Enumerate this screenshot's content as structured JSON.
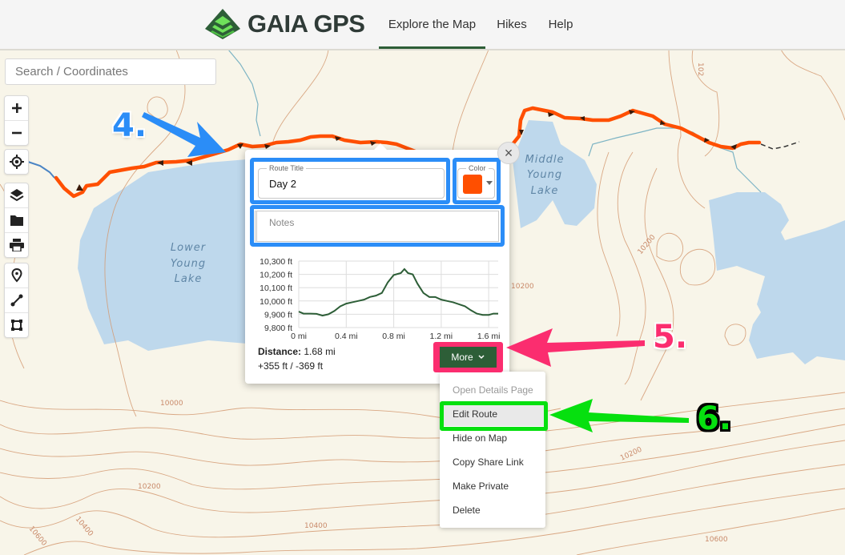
{
  "header": {
    "brand": "GAIA GPS",
    "nav": [
      {
        "label": "Explore the Map",
        "active": true
      },
      {
        "label": "Hikes",
        "active": false
      },
      {
        "label": "Help",
        "active": false
      }
    ]
  },
  "search": {
    "placeholder": "Search / Coordinates",
    "value": ""
  },
  "map_controls": {
    "zoom": [
      "zoom-in",
      "zoom-out"
    ],
    "locate": "locate",
    "tools": [
      "layers",
      "folder",
      "print"
    ],
    "draw": [
      "waypoint",
      "route",
      "area"
    ]
  },
  "map_labels": {
    "lakes": [
      {
        "lines": [
          "Lower",
          "Young",
          "Lake"
        ]
      },
      {
        "lines": [
          "Middle",
          "Young",
          "Lake"
        ]
      }
    ],
    "contours": [
      "10000",
      "10200",
      "10200",
      "10200",
      "10400",
      "10400",
      "10600",
      "10600",
      "10200",
      "102"
    ]
  },
  "popup": {
    "close_label": "×",
    "route_title_label": "Route Title",
    "route_title_value": "Day 2",
    "color_label": "Color",
    "color_value": "#ff4f00",
    "notes_placeholder": "Notes",
    "notes_value": "",
    "distance_label": "Distance:",
    "distance_value": "1.68 mi",
    "elevation_change": "+355 ft / -369 ft",
    "more_label": "More"
  },
  "more_menu": {
    "items": [
      {
        "label": "Open Details Page",
        "disabled": true
      },
      {
        "label": "Edit Route",
        "disabled": false,
        "highlighted": true
      },
      {
        "label": "Hide on Map",
        "disabled": false
      },
      {
        "label": "Copy Share Link",
        "disabled": false
      },
      {
        "label": "Make Private",
        "disabled": false
      },
      {
        "label": "Delete",
        "disabled": false
      }
    ]
  },
  "annotations": {
    "step4": "4.",
    "step5": "5.",
    "step6": "6.",
    "colors": {
      "step4": "#2b8df7",
      "step5": "#fb2d6f",
      "step6": "#06e00f"
    }
  },
  "colors": {
    "brand_green": "#2d5e37",
    "route": "#ff4f00",
    "water": "#bed8ec",
    "land": "#f8f5e9",
    "contour": "#d49a72"
  },
  "chart_data": {
    "type": "line",
    "title": "",
    "xlabel": "",
    "ylabel": "",
    "x_ticks": [
      "0 mi",
      "0.4 mi",
      "0.8 mi",
      "1.2 mi",
      "1.6 mi"
    ],
    "y_ticks": [
      "9,800 ft",
      "9,900 ft",
      "10,000 ft",
      "10,100 ft",
      "10,200 ft",
      "10,300 ft"
    ],
    "xlim": [
      0,
      1.68
    ],
    "ylim": [
      9800,
      10300
    ],
    "grid": true,
    "series": [
      {
        "name": "Elevation",
        "color": "#2d5e37",
        "x": [
          0,
          0.04,
          0.1,
          0.15,
          0.2,
          0.25,
          0.3,
          0.35,
          0.4,
          0.45,
          0.5,
          0.55,
          0.6,
          0.65,
          0.7,
          0.75,
          0.8,
          0.84,
          0.86,
          0.89,
          0.92,
          0.96,
          1.0,
          1.05,
          1.1,
          1.15,
          1.2,
          1.25,
          1.3,
          1.35,
          1.4,
          1.45,
          1.5,
          1.55,
          1.6,
          1.64,
          1.68
        ],
        "y": [
          9920,
          9905,
          9905,
          9903,
          9890,
          9900,
          9925,
          9960,
          9980,
          9990,
          10000,
          10010,
          10030,
          10040,
          10060,
          10140,
          10195,
          10205,
          10210,
          10240,
          10210,
          10200,
          10130,
          10060,
          10030,
          10030,
          10010,
          10000,
          9990,
          9975,
          9960,
          9930,
          9905,
          9895,
          9895,
          9905,
          9905
        ]
      }
    ]
  }
}
